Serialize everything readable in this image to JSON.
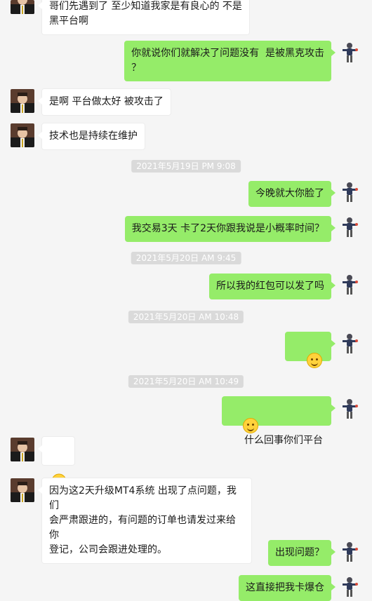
{
  "messages": [
    {
      "id": "m1",
      "side": "in",
      "text": "哥们先遇到了 至少知道我家是有良心的 不是\n黑平台啊"
    },
    {
      "id": "m2",
      "side": "out",
      "text": "你就说你们就解决了问题没有  是被黑克攻击\n？"
    },
    {
      "id": "m3",
      "side": "in",
      "text": "是啊 平台做太好 被攻击了"
    },
    {
      "id": "m4",
      "side": "in",
      "text": "技术也是持续在维护"
    },
    {
      "id": "t1",
      "type": "timestamp",
      "text": "2021年5月19日 PM 9:08"
    },
    {
      "id": "m5",
      "side": "out",
      "text": "今晚就大你脸了"
    },
    {
      "id": "m6",
      "side": "out",
      "text": "我交易3天 卡了2天你跟我说是小概率时间？"
    },
    {
      "id": "t2",
      "type": "timestamp",
      "text": "2021年5月20日 AM 9:45"
    },
    {
      "id": "m7",
      "side": "out",
      "text": "所以我的红包可以发了吗"
    },
    {
      "id": "t3",
      "type": "timestamp",
      "text": "2021年5月20日 AM 10:48"
    },
    {
      "id": "m8",
      "side": "out",
      "emoji": "smile"
    },
    {
      "id": "t4",
      "type": "timestamp",
      "text": "2021年5月20日 AM 10:49"
    },
    {
      "id": "m9",
      "side": "out",
      "emoji": "smile",
      "text": "什么回事你们平台"
    },
    {
      "id": "m10",
      "side": "in",
      "emoji": "crying"
    },
    {
      "id": "m11",
      "side": "in",
      "text": "因为这2天升级MT4系统 出现了点问题，我们\n会严肃跟进的，有问题的订单也请发过来给你\n登记，公司会跟进处理的。"
    },
    {
      "id": "m12",
      "side": "out",
      "text": "出现问题？"
    },
    {
      "id": "m13",
      "side": "out",
      "text": "这直接把我卡爆仓"
    }
  ],
  "colors": {
    "outgoing_bubble": "#95ec69",
    "incoming_bubble": "#ffffff",
    "background": "#f5f5f5",
    "timestamp_bg": "#dadada"
  }
}
